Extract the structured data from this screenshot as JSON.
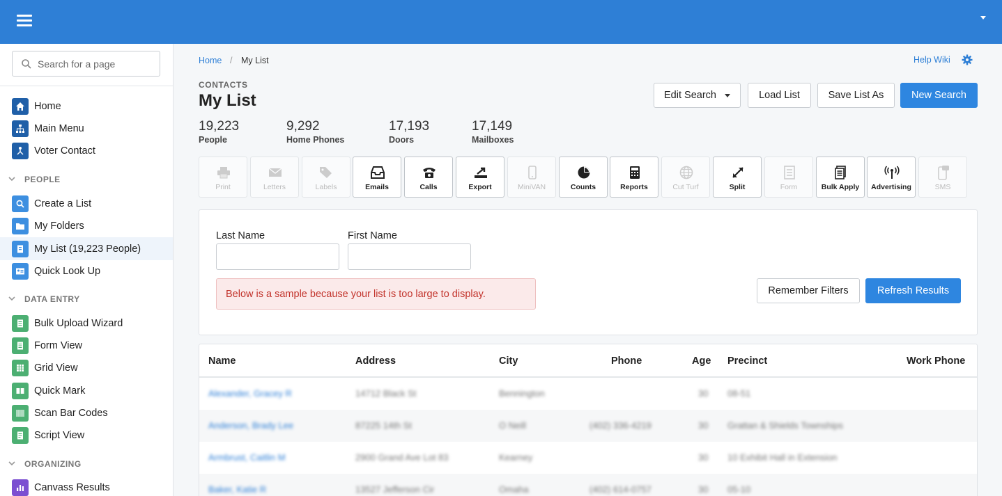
{
  "sidebar": {
    "search_placeholder": "Search for a page",
    "items_top": [
      {
        "label": "Home",
        "icon": "home-icon",
        "color": "#1f5fa8"
      },
      {
        "label": "Main Menu",
        "icon": "sitemap-icon",
        "color": "#1f5fa8"
      },
      {
        "label": "Voter Contact",
        "icon": "people-network-icon",
        "color": "#1f5fa8"
      }
    ],
    "sections": [
      {
        "label": "PEOPLE",
        "items": [
          {
            "label": "Create a List",
            "icon": "search-icon",
            "color": "#3d8fe0"
          },
          {
            "label": "My Folders",
            "icon": "folder-icon",
            "color": "#3d8fe0"
          },
          {
            "label": "My List (19,223 People)",
            "icon": "list-icon",
            "color": "#3d8fe0",
            "active": true
          },
          {
            "label": "Quick Look Up",
            "icon": "id-card-icon",
            "color": "#3d8fe0"
          }
        ]
      },
      {
        "label": "DATA ENTRY",
        "items": [
          {
            "label": "Bulk Upload Wizard",
            "icon": "upload-doc-icon",
            "color": "#4caf72"
          },
          {
            "label": "Form View",
            "icon": "form-icon",
            "color": "#4caf72"
          },
          {
            "label": "Grid View",
            "icon": "grid-icon",
            "color": "#4caf72"
          },
          {
            "label": "Quick Mark",
            "icon": "book-icon",
            "color": "#4caf72"
          },
          {
            "label": "Scan Bar Codes",
            "icon": "barcode-icon",
            "color": "#4caf72"
          },
          {
            "label": "Script View",
            "icon": "script-icon",
            "color": "#4caf72"
          }
        ]
      },
      {
        "label": "ORGANIZING",
        "items": [
          {
            "label": "Canvass Results",
            "icon": "bar-chart-icon",
            "color": "#7b4fd1"
          }
        ]
      }
    ]
  },
  "breadcrumb": {
    "home": "Home",
    "separator": "/",
    "current": "My List"
  },
  "help_wiki": "Help Wiki",
  "header": {
    "kicker": "CONTACTS",
    "title": "My List"
  },
  "actions": {
    "edit_search": "Edit Search",
    "load_list": "Load List",
    "save_list_as": "Save List As",
    "new_search": "New Search"
  },
  "stats": [
    {
      "value": "19,223",
      "label": "People"
    },
    {
      "value": "9,292",
      "label": "Home Phones"
    },
    {
      "value": "17,193",
      "label": "Doors"
    },
    {
      "value": "17,149",
      "label": "Mailboxes"
    }
  ],
  "tools": [
    {
      "label": "Print",
      "icon": "printer-icon",
      "enabled": false
    },
    {
      "label": "Letters",
      "icon": "envelope-icon",
      "enabled": false
    },
    {
      "label": "Labels",
      "icon": "tags-icon",
      "enabled": false
    },
    {
      "label": "Emails",
      "icon": "inbox-icon",
      "enabled": true
    },
    {
      "label": "Calls",
      "icon": "telephone-icon",
      "enabled": true
    },
    {
      "label": "Export",
      "icon": "export-icon",
      "enabled": true
    },
    {
      "label": "MiniVAN",
      "icon": "mobile-icon",
      "enabled": false
    },
    {
      "label": "Counts",
      "icon": "pie-chart-icon",
      "enabled": true
    },
    {
      "label": "Reports",
      "icon": "calculator-icon",
      "enabled": true
    },
    {
      "label": "Cut Turf",
      "icon": "globe-icon",
      "enabled": false
    },
    {
      "label": "Split",
      "icon": "split-arrows-icon",
      "enabled": true
    },
    {
      "label": "Form",
      "icon": "form-icon",
      "enabled": false
    },
    {
      "label": "Bulk Apply",
      "icon": "stack-icon",
      "enabled": true
    },
    {
      "label": "Advertising",
      "icon": "broadcast-icon",
      "enabled": true
    },
    {
      "label": "SMS",
      "icon": "sms-icon",
      "enabled": false
    }
  ],
  "filters": {
    "last_name_label": "Last Name",
    "last_name_value": "",
    "first_name_label": "First Name",
    "first_name_value": "",
    "alert": "Below is a sample because your list is too large to display.",
    "remember_filters": "Remember Filters",
    "refresh_results": "Refresh Results"
  },
  "table": {
    "columns": [
      "Name",
      "Address",
      "City",
      "Phone",
      "Age",
      "Precinct",
      "Work Phone"
    ],
    "rows": [
      [
        "Alexander, Gracey R",
        "14712 Black St",
        "Bennington",
        "",
        "30",
        "08-51",
        ""
      ],
      [
        "Anderson, Brady Lee",
        "87225 14th St",
        "O Neill",
        "(402) 336-4219",
        "30",
        "Grattan & Shields Townships",
        ""
      ],
      [
        "Armbrust, Caitlin M",
        "2900 Grand Ave Lot 83",
        "Kearney",
        "",
        "30",
        "10 Exhibit Hall in Extension",
        ""
      ],
      [
        "Baker, Katie R",
        "13527 Jefferson Cir",
        "Omaha",
        "(402) 614-0757",
        "30",
        "05-10",
        ""
      ]
    ]
  },
  "colors": {
    "topbar": "#2e7fd6",
    "primary_button": "#2e86e0",
    "alert_text": "#c2332b",
    "alert_bg": "#fbeaea",
    "link": "#2e7fd6"
  }
}
